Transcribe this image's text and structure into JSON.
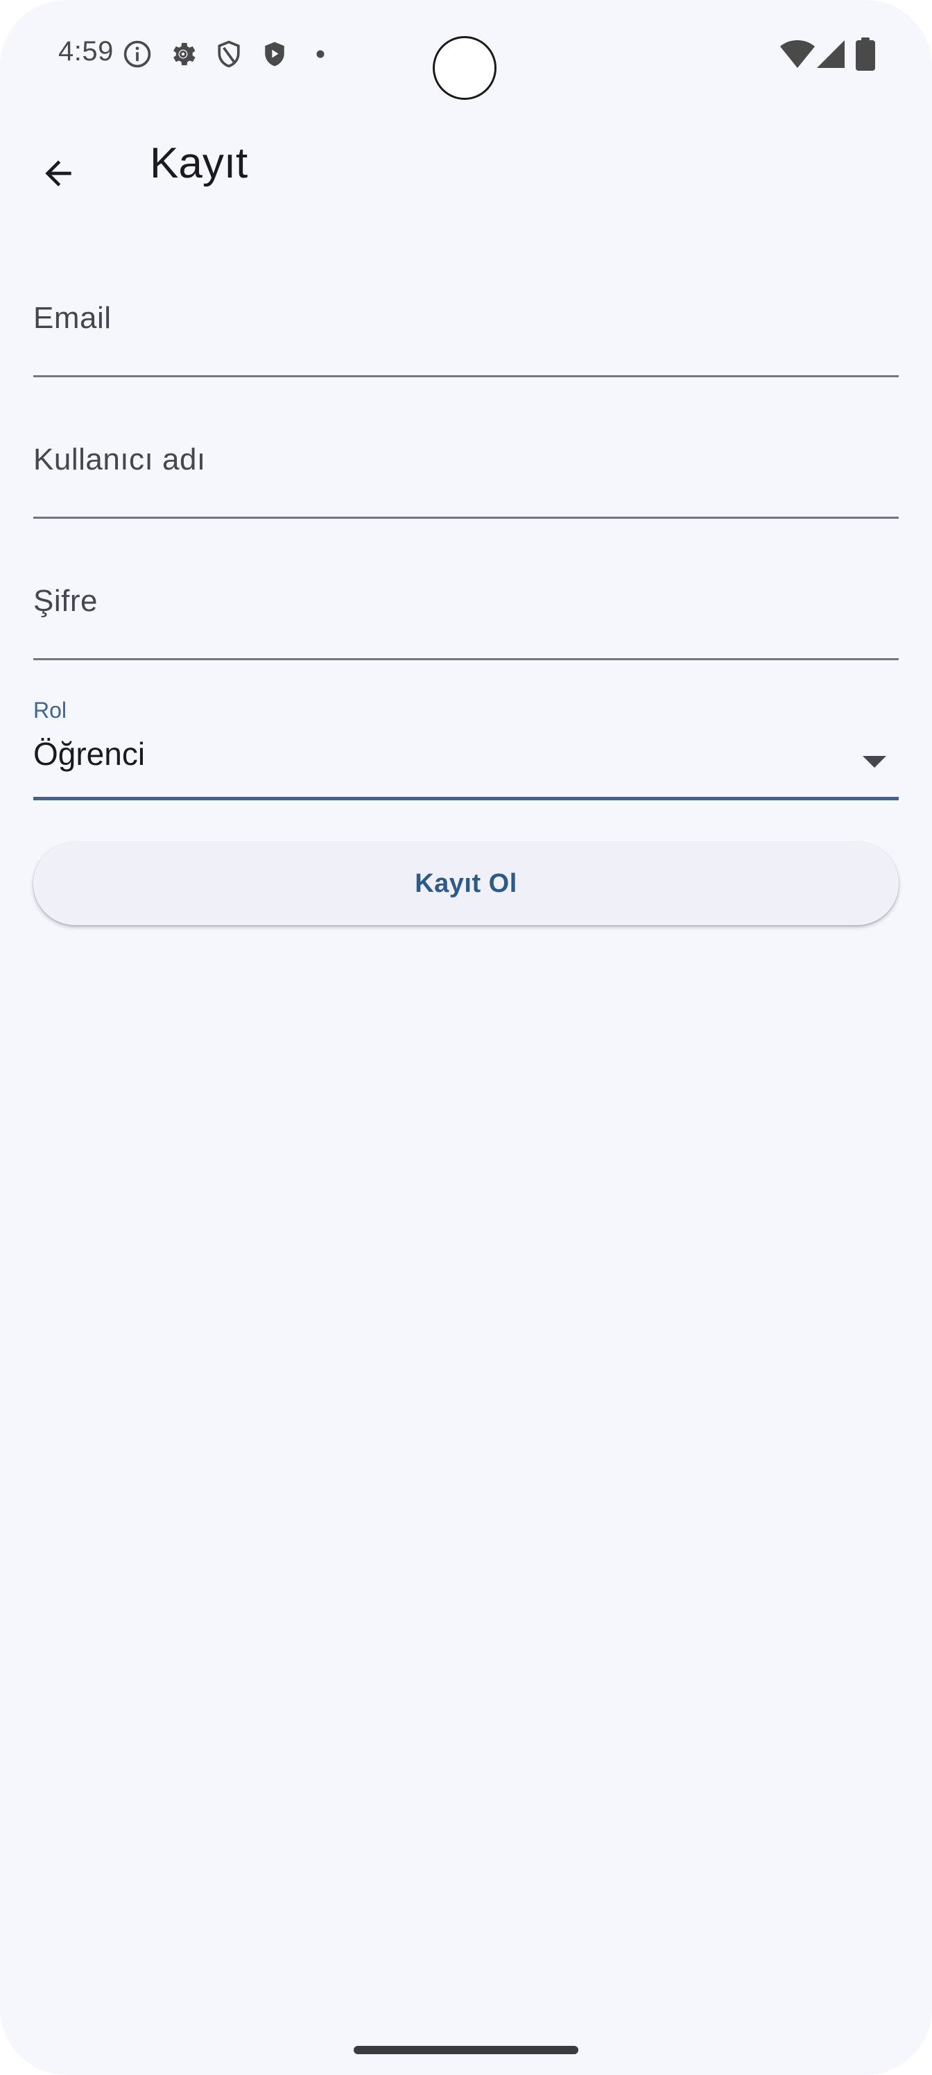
{
  "status_bar": {
    "time": "4:59",
    "icons": [
      "info-icon",
      "settings-icon",
      "shield-icon",
      "play-protect-icon",
      "dot-icon",
      "wifi-icon",
      "signal-icon",
      "battery-icon"
    ]
  },
  "app_bar": {
    "back_icon": "arrow-back-icon",
    "title": "Kayıt"
  },
  "form": {
    "email": {
      "label": "Email",
      "value": ""
    },
    "username": {
      "label": "Kullanıcı adı",
      "value": ""
    },
    "password": {
      "label": "Şifre",
      "value": ""
    },
    "role": {
      "label": "Rol",
      "selected": "Öğrenci"
    },
    "submit_label": "Kayıt Ol"
  },
  "colors": {
    "background": "#f6f7fc",
    "primary": "#3f6490",
    "text": "#1b1b1f",
    "button_bg": "#f0f1f8"
  }
}
